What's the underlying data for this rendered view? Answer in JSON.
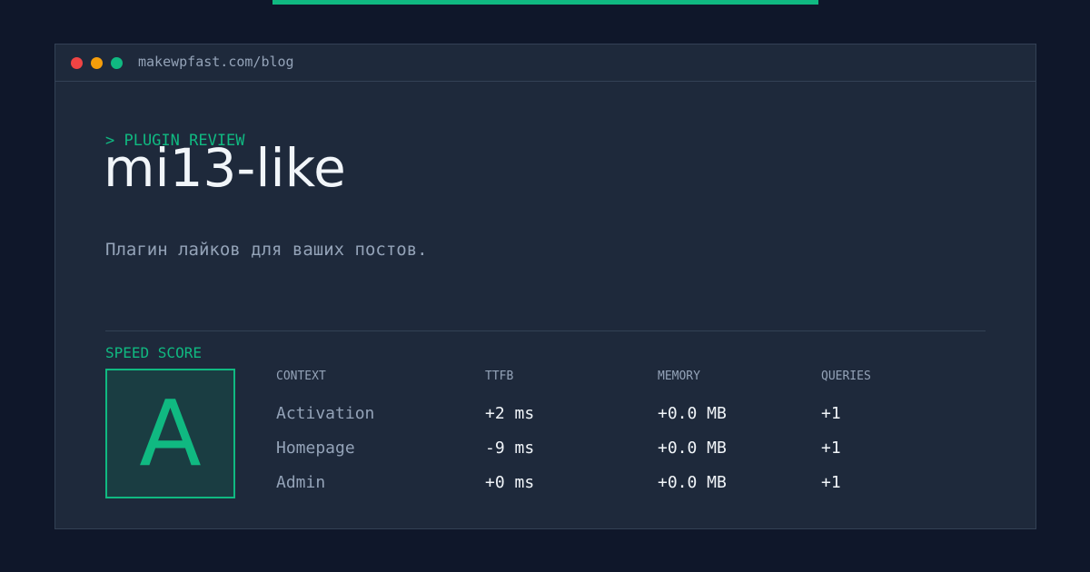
{
  "colors": {
    "page_background": "#0f172a",
    "panel_background": "#1e293b",
    "accent": "#10b981",
    "border": "#334155",
    "muted_text": "#94a3b8",
    "primary_text": "#f1f5f9",
    "dot_red": "#ef4444",
    "dot_yellow": "#f59e0b",
    "dot_green": "#10b981"
  },
  "window": {
    "url": "makewpfast.com/blog"
  },
  "plugin": {
    "eyebrow": "> PLUGIN REVIEW",
    "name": "mi13-like",
    "description": "Плагин лайков для ваших постов."
  },
  "speed": {
    "label": "SPEED SCORE",
    "grade": "A"
  },
  "table": {
    "headers": [
      "CONTEXT",
      "TTFB",
      "MEMORY",
      "QUERIES"
    ],
    "rows": [
      {
        "context": "Activation",
        "ttfb": "+2 ms",
        "memory": "+0.0 MB",
        "queries": "+1"
      },
      {
        "context": "Homepage",
        "ttfb": "-9 ms",
        "memory": "+0.0 MB",
        "queries": "+1"
      },
      {
        "context": "Admin",
        "ttfb": "+0 ms",
        "memory": "+0.0 MB",
        "queries": "+1"
      }
    ]
  }
}
